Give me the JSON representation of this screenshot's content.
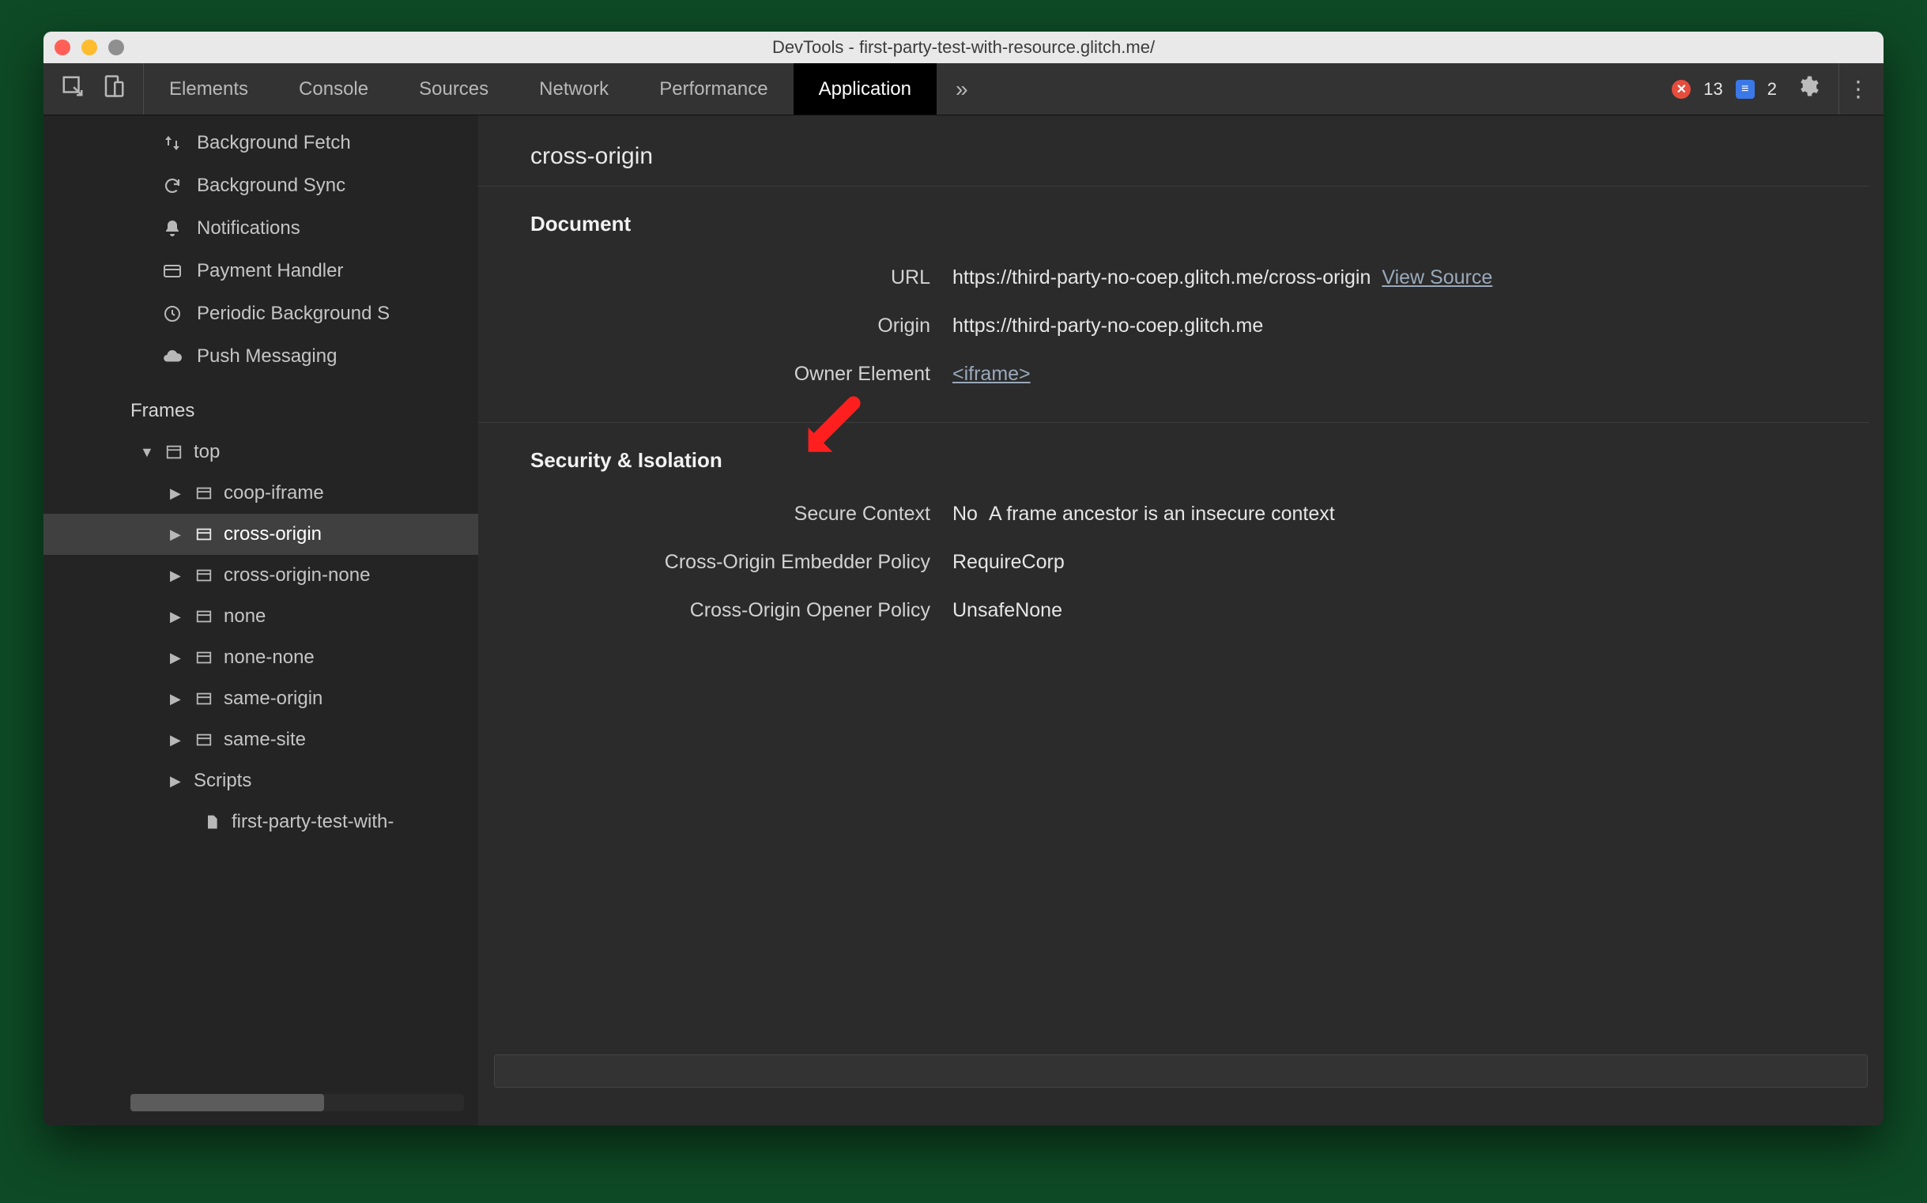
{
  "window": {
    "title": "DevTools - first-party-test-with-resource.glitch.me/"
  },
  "tabs": {
    "items": [
      "Elements",
      "Console",
      "Sources",
      "Network",
      "Performance",
      "Application"
    ],
    "active_index": 5,
    "more_glyph": "»",
    "errors_count": "13",
    "info_count": "2"
  },
  "sidebar": {
    "items": [
      {
        "icon": "updown",
        "label": "Background Fetch"
      },
      {
        "icon": "sync",
        "label": "Background Sync"
      },
      {
        "icon": "bell",
        "label": "Notifications"
      },
      {
        "icon": "card",
        "label": "Payment Handler"
      },
      {
        "icon": "clock",
        "label": "Periodic Background S"
      },
      {
        "icon": "cloud",
        "label": "Push Messaging"
      }
    ],
    "frames_title": "Frames",
    "tree": {
      "top_label": "top",
      "children": [
        {
          "label": "coop-iframe"
        },
        {
          "label": "cross-origin",
          "selected": true
        },
        {
          "label": "cross-origin-none"
        },
        {
          "label": "none"
        },
        {
          "label": "none-none"
        },
        {
          "label": "same-origin"
        },
        {
          "label": "same-site"
        },
        {
          "label": "Scripts",
          "icon": "none"
        }
      ],
      "leaf": {
        "label": "first-party-test-with-"
      }
    }
  },
  "main": {
    "title": "cross-origin",
    "document": {
      "heading": "Document",
      "url_label": "URL",
      "url_value": "https://third-party-no-coep.glitch.me/cross-origin",
      "view_source": "View Source",
      "origin_label": "Origin",
      "origin_value": "https://third-party-no-coep.glitch.me",
      "owner_label": "Owner Element",
      "owner_value": "<iframe>"
    },
    "security": {
      "heading": "Security & Isolation",
      "secure_label": "Secure Context",
      "secure_value": "No",
      "secure_note": "A frame ancestor is an insecure context",
      "coep_label": "Cross-Origin Embedder Policy",
      "coep_value": "RequireCorp",
      "coop_label": "Cross-Origin Opener Policy",
      "coop_value": "UnsafeNone"
    }
  }
}
